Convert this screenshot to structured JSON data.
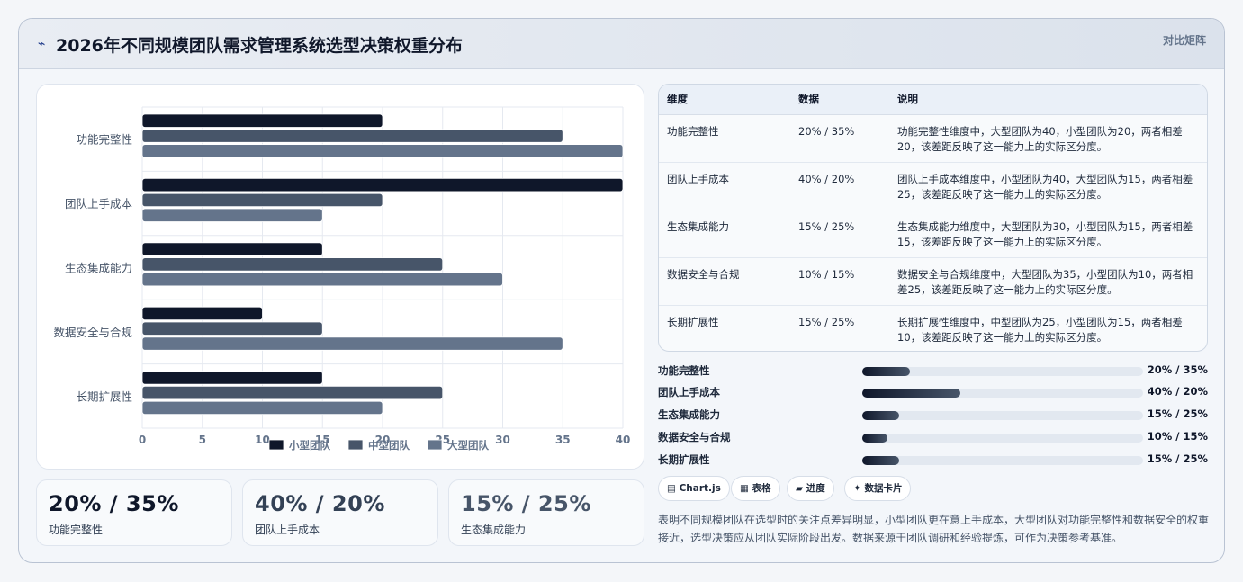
{
  "header": {
    "title": "2026年不同规模团队需求管理系统选型决策权重分布",
    "tag": "对比矩阵",
    "icon": "chart-icon"
  },
  "chart_data": {
    "type": "bar",
    "orientation": "horizontal",
    "categories": [
      "功能完整性",
      "团队上手成本",
      "生态集成能力",
      "数据安全与合规",
      "长期扩展性"
    ],
    "series": [
      {
        "name": "小型团队",
        "values": [
          20,
          40,
          15,
          10,
          15
        ],
        "color": "#0f172a"
      },
      {
        "name": "中型团队",
        "values": [
          35,
          20,
          25,
          15,
          25
        ],
        "color": "#475569"
      },
      {
        "name": "大型团队",
        "values": [
          40,
          15,
          30,
          35,
          20
        ],
        "color": "#64748b"
      }
    ],
    "xlim": [
      0,
      40
    ],
    "xticks": [
      0,
      5,
      10,
      15,
      20,
      25,
      30,
      35,
      40
    ],
    "grid": true,
    "legend": "bottom"
  },
  "kpis": [
    {
      "value": "20% / 35%",
      "label": "功能完整性",
      "color": "#0f172a"
    },
    {
      "value": "40% / 20%",
      "label": "团队上手成本",
      "color": "#334155"
    },
    {
      "value": "15% / 25%",
      "label": "生态集成能力",
      "color": "#475569"
    }
  ],
  "table": {
    "headers": [
      "维度",
      "数据",
      "说明"
    ],
    "rows": [
      {
        "dim": "功能完整性",
        "data": "20% / 35%",
        "desc": "功能完整性维度中，大型团队为40，小型团队为20，两者相差20，该差距反映了这一能力上的实际区分度。"
      },
      {
        "dim": "团队上手成本",
        "data": "40% / 20%",
        "desc": "团队上手成本维度中，小型团队为40，大型团队为15，两者相差25，该差距反映了这一能力上的实际区分度。"
      },
      {
        "dim": "生态集成能力",
        "data": "15% / 25%",
        "desc": "生态集成能力维度中，大型团队为30，小型团队为15，两者相差15，该差距反映了这一能力上的实际区分度。"
      },
      {
        "dim": "数据安全与合规",
        "data": "10% / 15%",
        "desc": "数据安全与合规维度中，大型团队为35，小型团队为10，两者相差25，该差距反映了这一能力上的实际区分度。"
      },
      {
        "dim": "长期扩展性",
        "data": "15% / 25%",
        "desc": "长期扩展性维度中，中型团队为25，小型团队为15，两者相差10，该差距反映了这一能力上的实际区分度。"
      }
    ]
  },
  "progress": [
    {
      "label": "功能完整性",
      "value": "20% / 35%",
      "fill_percent": 17
    },
    {
      "label": "团队上手成本",
      "value": "40% / 20%",
      "fill_percent": 35
    },
    {
      "label": "生态集成能力",
      "value": "15% / 25%",
      "fill_percent": 13
    },
    {
      "label": "数据安全与合规",
      "value": "10% / 15%",
      "fill_percent": 9
    },
    {
      "label": "长期扩展性",
      "value": "15% / 25%",
      "fill_percent": 13
    }
  ],
  "chips": [
    {
      "icon": "▤",
      "label": "Chart.js"
    },
    {
      "icon": "▦",
      "label": "表格"
    },
    {
      "icon": "▰",
      "label": "进度"
    },
    {
      "icon": "✦",
      "label": "数据卡片"
    }
  ],
  "note": "表明不同规模团队在选型时的关注点差异明显，小型团队更在意上手成本，大型团队对功能完整性和数据安全的权重接近，选型决策应从团队实际阶段出发。数据来源于团队调研和经验提炼，可作为决策参考基准。"
}
